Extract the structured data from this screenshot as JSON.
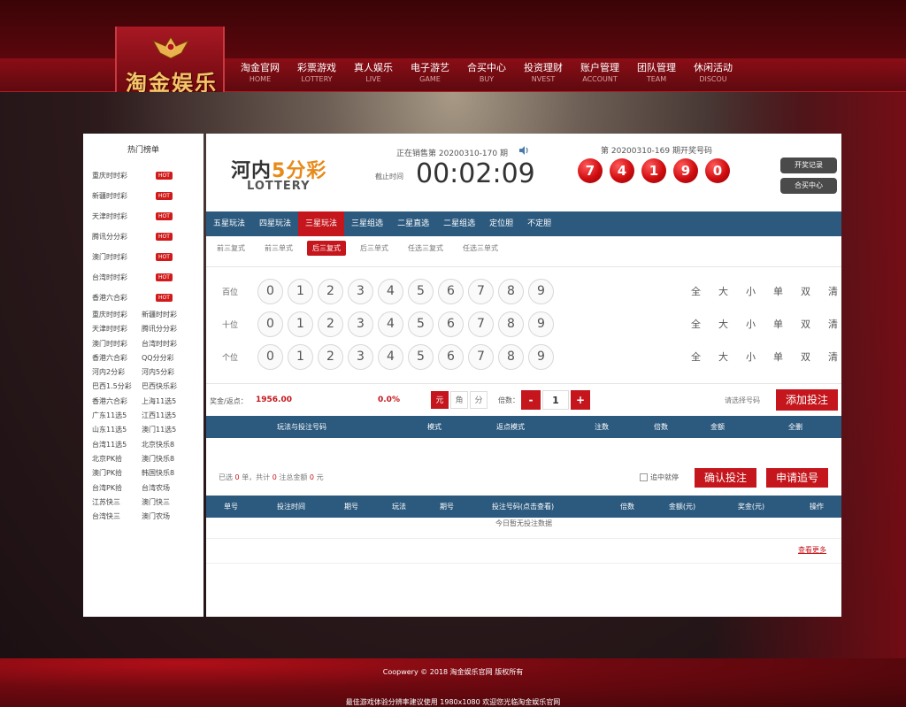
{
  "brand": {
    "name": "淘金娱乐"
  },
  "nav": [
    {
      "cn": "淘金官网",
      "en": "HOME"
    },
    {
      "cn": "彩票游戏",
      "en": "LOTTERY"
    },
    {
      "cn": "真人娱乐",
      "en": "LIVE"
    },
    {
      "cn": "电子游艺",
      "en": "GAME"
    },
    {
      "cn": "合买中心",
      "en": "BUY"
    },
    {
      "cn": "投资理财",
      "en": "NVEST"
    },
    {
      "cn": "账户管理",
      "en": "ACCOUNT"
    },
    {
      "cn": "团队管理",
      "en": "TEAM"
    },
    {
      "cn": "休闲活动",
      "en": "DISCOU"
    }
  ],
  "sidebar": {
    "title": "热门榜单",
    "hot_badge": "HOT",
    "hot_items": [
      "重庆时时彩",
      "新疆时时彩",
      "天津时时彩",
      "腾讯分分彩",
      "澳门时时彩",
      "台湾时时彩",
      "香港六合彩"
    ],
    "grid_items": [
      "重庆时时彩",
      "新疆时时彩",
      "天津时时彩",
      "腾讯分分彩",
      "澳门时时彩",
      "台湾时时彩",
      "香港六合彩",
      "QQ分分彩",
      "河内2分彩",
      "河内5分彩",
      "巴西1.5分彩",
      "巴西快乐彩",
      "香港六合彩",
      "上海11选5",
      "广东11选5",
      "江西11选5",
      "山东11选5",
      "澳门11选5",
      "台湾11选5",
      "北京快乐8",
      "北京PK拾",
      "澳门快乐8",
      "澳门PK拾",
      "韩国快乐8",
      "台湾PK拾",
      "台湾农场",
      "江苏快三",
      "澳门快三",
      "台湾快三",
      "澳门农场"
    ]
  },
  "game": {
    "name_prefix": "河内",
    "name_accent": "5分彩",
    "sub": "LOTTERY",
    "sale_period": "正在销售第 20200310-170 期",
    "deadline_label": "截止时间",
    "countdown": "00:02:09",
    "open_title": "第 20200310-169 期开奖号码",
    "balls": [
      "7",
      "4",
      "1",
      "9",
      "0"
    ],
    "btn_history": "开奖记录",
    "btn_combo": "合买中心"
  },
  "tabs": [
    "五星玩法",
    "四星玩法",
    "三星玩法",
    "三星组选",
    "二星直选",
    "二星组选",
    "定位胆",
    "不定胆"
  ],
  "subtabs": [
    "前三复式",
    "前三单式",
    "后三复式",
    "后三单式",
    "任选三复式",
    "任选三单式"
  ],
  "rows": [
    {
      "label": "百位"
    },
    {
      "label": "十位"
    },
    {
      "label": "个位"
    }
  ],
  "digits": [
    "0",
    "1",
    "2",
    "3",
    "4",
    "5",
    "6",
    "7",
    "8",
    "9"
  ],
  "quick": [
    "全",
    "大",
    "小",
    "单",
    "双",
    "清"
  ],
  "bet": {
    "bonus_label": "奖金/返点：",
    "bonus_value": "1956.00",
    "rebate": "0.0%",
    "units": [
      "元",
      "角",
      "分"
    ],
    "multiple_label": "倍数：",
    "minus": "-",
    "plus": "+",
    "multiple_value": "1",
    "select_hint": "请选择号码",
    "add_button": "添加投注"
  },
  "cart_table": {
    "headers": [
      "玩法与投注号码",
      "模式",
      "返点模式",
      "注数",
      "倍数",
      "金额",
      "全删"
    ]
  },
  "order": {
    "summary_prefix": "已选",
    "count": "0",
    "summary_mid": "单，共计",
    "bets": "0",
    "summary_mid2": "注总金额",
    "amount": "0",
    "summary_suffix": "元",
    "chase_stop_label": "追中就停",
    "confirm_button": "确认投注",
    "chase_button": "申请追号"
  },
  "records_table": {
    "headers": [
      "单号",
      "投注时间",
      "期号",
      "玩法",
      "期号",
      "投注号码(点击查看)",
      "倍数",
      "金额(元)",
      "奖金(元)",
      "操作"
    ],
    "empty": "今日暂无投注数据",
    "view_more": "查看更多"
  },
  "footer": {
    "copyright": "Coopwery © 2018 淘金娱乐官网 版权所有",
    "tip": "最佳游戏体验分辨率建议使用 1980x1080 欢迎您光临淘金娱乐官网"
  }
}
